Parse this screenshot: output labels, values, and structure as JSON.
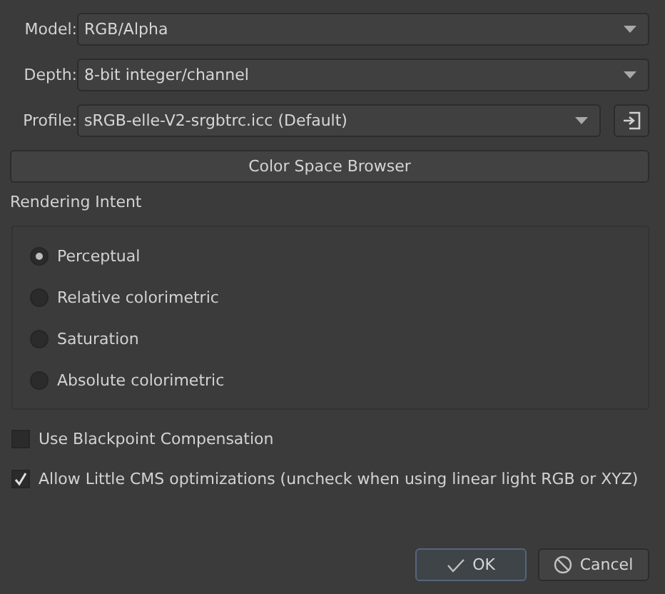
{
  "fields": [
    {
      "label": "Model:",
      "value": "RGB/Alpha"
    },
    {
      "label": "Depth:",
      "value": "8-bit integer/channel"
    },
    {
      "label": "Profile:",
      "value": "sRGB-elle-V2-srgbtrc.icc (Default)",
      "has_import_button": true
    }
  ],
  "browser_button": "Color Space Browser",
  "rendering_intent": {
    "title": "Rendering Intent",
    "options": [
      {
        "label": "Perceptual",
        "selected": true
      },
      {
        "label": "Relative colorimetric",
        "selected": false
      },
      {
        "label": "Saturation",
        "selected": false
      },
      {
        "label": "Absolute colorimetric",
        "selected": false
      }
    ]
  },
  "checkboxes": [
    {
      "label": "Use Blackpoint Compensation",
      "checked": false
    },
    {
      "label": "Allow Little CMS optimizations (uncheck when using linear light RGB or XYZ)",
      "checked": true
    }
  ],
  "buttons": [
    {
      "kind": "ok",
      "label": "OK"
    },
    {
      "kind": "cancel",
      "label": "Cancel"
    }
  ]
}
